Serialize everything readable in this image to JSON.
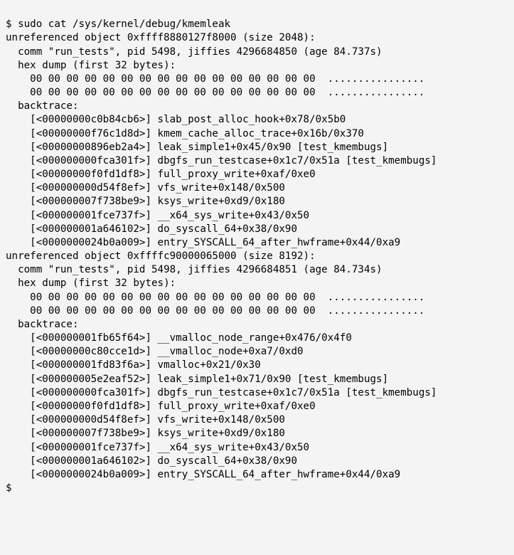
{
  "prompt": "$",
  "command": "sudo cat /sys/kernel/debug/kmemleak",
  "leaks": [
    {
      "address": "0xffff8880127f8000",
      "size": 2048,
      "comm": "run_tests",
      "pid": 5498,
      "jiffies": "4296684850",
      "age": "84.737s",
      "hexdump_label": "hex dump (first 32 bytes):",
      "hex_lines": [
        "00 00 00 00 00 00 00 00 00 00 00 00 00 00 00 00  ................",
        "00 00 00 00 00 00 00 00 00 00 00 00 00 00 00 00  ................"
      ],
      "backtrace_label": "backtrace:",
      "backtrace": [
        {
          "addr": "00000000c0b84cb6",
          "sym": "slab_post_alloc_hook+0x78/0x5b0"
        },
        {
          "addr": "00000000f76c1d8d",
          "sym": "kmem_cache_alloc_trace+0x16b/0x370"
        },
        {
          "addr": "00000000896eb2a4",
          "sym": "leak_simple1+0x45/0x90 [test_kmembugs]"
        },
        {
          "addr": "00000000fca301f",
          "sym": "dbgfs_run_testcase+0x1c7/0x51a [test_kmembugs]"
        },
        {
          "addr": "00000000f0fd1df8",
          "sym": "full_proxy_write+0xaf/0xe0"
        },
        {
          "addr": "00000000d54f8ef",
          "sym": "vfs_write+0x148/0x500"
        },
        {
          "addr": "000000007f738be9",
          "sym": "ksys_write+0xd9/0x180"
        },
        {
          "addr": "000000001fce737f",
          "sym": "__x64_sys_write+0x43/0x50"
        },
        {
          "addr": "000000001a646102",
          "sym": "do_syscall_64+0x38/0x90"
        },
        {
          "addr": "0000000024b0a009",
          "sym": "entry_SYSCALL_64_after_hwframe+0x44/0xa9"
        }
      ]
    },
    {
      "address": "0xffffc90000065000",
      "size": 8192,
      "comm": "run_tests",
      "pid": 5498,
      "jiffies": "4296684851",
      "age": "84.734s",
      "hexdump_label": "hex dump (first 32 bytes):",
      "hex_lines": [
        "00 00 00 00 00 00 00 00 00 00 00 00 00 00 00 00  ................",
        "00 00 00 00 00 00 00 00 00 00 00 00 00 00 00 00  ................"
      ],
      "backtrace_label": "backtrace:",
      "backtrace": [
        {
          "addr": "000000001fb65f64",
          "sym": "__vmalloc_node_range+0x476/0x4f0"
        },
        {
          "addr": "00000000c80cce1d",
          "sym": "__vmalloc_node+0xa7/0xd0"
        },
        {
          "addr": "000000001fd83f6a",
          "sym": "vmalloc+0x21/0x30"
        },
        {
          "addr": "000000005e2eaf52",
          "sym": "leak_simple1+0x71/0x90 [test_kmembugs]"
        },
        {
          "addr": "00000000fca301f",
          "sym": "dbgfs_run_testcase+0x1c7/0x51a [test_kmembugs]"
        },
        {
          "addr": "00000000f0fd1df8",
          "sym": "full_proxy_write+0xaf/0xe0"
        },
        {
          "addr": "00000000d54f8ef",
          "sym": "vfs_write+0x148/0x500"
        },
        {
          "addr": "000000007f738be9",
          "sym": "ksys_write+0xd9/0x180"
        },
        {
          "addr": "000000001fce737f",
          "sym": "__x64_sys_write+0x43/0x50"
        },
        {
          "addr": "000000001a646102",
          "sym": "do_syscall_64+0x38/0x90"
        },
        {
          "addr": "0000000024b0a009",
          "sym": "entry_SYSCALL_64_after_hwframe+0x44/0xa9"
        }
      ]
    }
  ],
  "final_prompt": "$"
}
